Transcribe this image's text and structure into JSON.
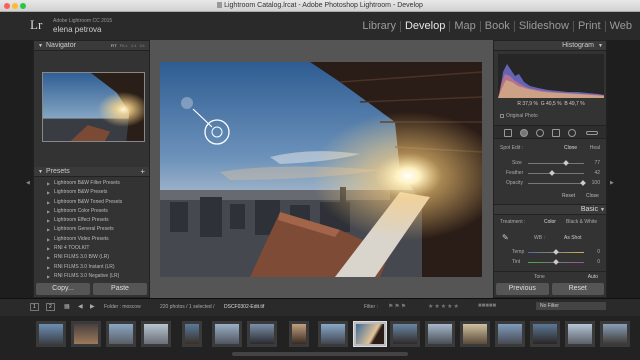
{
  "window": {
    "title": "Lightroom Catalog.lrcat - Adobe Photoshop Lightroom - Develop"
  },
  "identity": {
    "logo": "Lr",
    "product": "Adobe Lightroom CC 2015",
    "user": "elena petrova"
  },
  "modules": [
    "Library",
    "Develop",
    "Map",
    "Book",
    "Slideshow",
    "Print",
    "Web"
  ],
  "active_module": "Develop",
  "navigator": {
    "title": "Navigator",
    "zoom_options": [
      "FIT",
      "FILL",
      "1:1",
      "3:1"
    ]
  },
  "presets": {
    "title": "Presets",
    "items": [
      "Lightroom B&W Filter Presets",
      "Lightroom B&W Presets",
      "Lightroom B&W Toned Presets",
      "Lightroom Color Presets",
      "Lightroom Effect Presets",
      "Lightroom General Presets",
      "Lightroom Video Presets",
      "RNI 4 TOOLKIT",
      "RNI FILMS 3.0 B/W (LR)",
      "RNI FILMS 3.0 Instant (LR)",
      "RNI FILMS 3.0 Negative (LR)"
    ]
  },
  "left_buttons": {
    "copy": "Copy...",
    "paste": "Paste"
  },
  "histogram": {
    "title": "Histogram",
    "r_label": "R",
    "r_value": "37,9",
    "g_label": "G",
    "g_value": "40,5",
    "b_label": "B",
    "b_value": "49,7",
    "unit": "%",
    "original_photo": "Original Photo"
  },
  "spot_edit": {
    "label": "Spot Edit :",
    "clone": "Clone",
    "heal": "Heal",
    "size_label": "Size",
    "size_value": "77",
    "feather_label": "Feather",
    "feather_value": "42",
    "opacity_label": "Opacity",
    "opacity_value": "100",
    "reset": "Reset",
    "close": "Close"
  },
  "basic": {
    "title": "Basic",
    "treatment_label": "Treatment :",
    "color": "Color",
    "bw": "Black & White",
    "wb_label": "WB :",
    "wb_value": "As Shot",
    "temp_label": "Temp",
    "temp_value": "0",
    "tint_label": "Tint",
    "tint_value": "0",
    "tone_label": "Tone",
    "auto": "Auto"
  },
  "right_buttons": {
    "previous": "Previous",
    "reset": "Reset"
  },
  "filmstrip_bar": {
    "screen1": "1",
    "screen2": "2",
    "folder": "Folder : moscow",
    "count": "220 photos / 1 selected /",
    "filename": "DSCF0302-Edit.tif",
    "filter_label": "Filter :",
    "filter_value": "No Filter"
  },
  "colors": {
    "panel": "#333333",
    "header": "#2a2a2a",
    "active_text": "#e6e6e6",
    "sky_top": "#3c6a9a",
    "sun": "#ffe9a8"
  }
}
